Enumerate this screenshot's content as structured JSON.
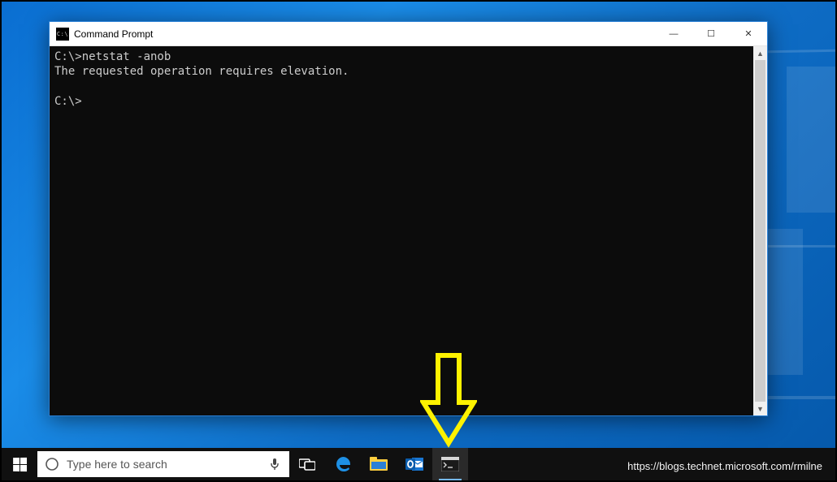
{
  "window": {
    "title": "Command Prompt",
    "icon_label": "C:\\",
    "lines": [
      "C:\\>netstat -anob",
      "The requested operation requires elevation.",
      "",
      "C:\\>"
    ]
  },
  "controls": {
    "minimize_glyph": "—",
    "maximize_glyph": "☐",
    "close_glyph": "✕",
    "scroll_up_glyph": "▲",
    "scroll_down_glyph": "▼"
  },
  "taskbar": {
    "search_placeholder": "Type here to search"
  },
  "watermark": "https://blogs.technet.microsoft.com/rmilne"
}
